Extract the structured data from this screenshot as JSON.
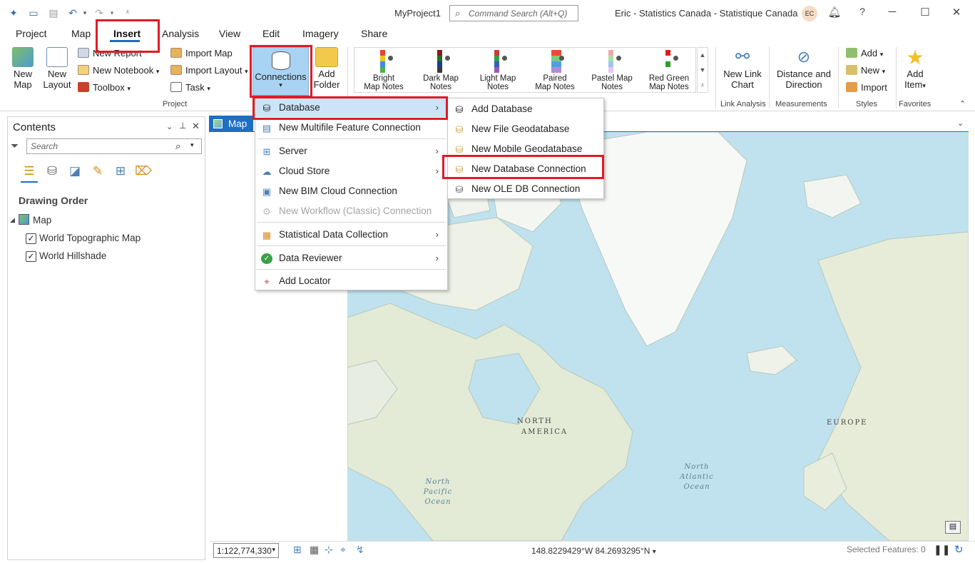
{
  "window": {
    "title": "MyProject1",
    "command_search_placeholder": "Command Search (Alt+Q)",
    "user": "Eric - Statistics Canada - Statistique Canada",
    "avatar_initials": "EC",
    "help_label": "?"
  },
  "tabs": [
    "Project",
    "Map",
    "Insert",
    "Analysis",
    "View",
    "Edit",
    "Imagery",
    "Share"
  ],
  "ribbon": {
    "project": {
      "new_map": "New Map",
      "new_layout": "New Layout",
      "new_report": "New Report",
      "new_notebook": "New Notebook",
      "toolbox": "Toolbox",
      "import_map": "Import Map",
      "import_layout": "Import Layout",
      "task": "Task",
      "connections": "Connections",
      "add_folder_1": "Add",
      "add_folder_2": "Folder",
      "group_label": "Project"
    },
    "notes": [
      {
        "l1": "Bright",
        "l2": "Map Notes"
      },
      {
        "l1": "Dark Map",
        "l2": "Notes"
      },
      {
        "l1": "Light Map",
        "l2": "Notes"
      },
      {
        "l1": "Paired",
        "l2": "Map Notes"
      },
      {
        "l1": "Pastel Map",
        "l2": "Notes"
      },
      {
        "l1": "Red Green",
        "l2": "Map Notes"
      }
    ],
    "link": {
      "l1": "New Link",
      "l2": "Chart",
      "group": "Link Analysis"
    },
    "measure": {
      "l1": "Distance and",
      "l2": "Direction",
      "group": "Measurements"
    },
    "styles": {
      "add": "Add",
      "new": "New",
      "import": "Import",
      "group": "Styles"
    },
    "favorites": {
      "l1": "Add",
      "l2": "Item",
      "group": "Favorites"
    }
  },
  "contents": {
    "title": "Contents",
    "search_placeholder": "Search",
    "drawing_order": "Drawing Order",
    "map_layer": "Map",
    "layers": [
      "World Topographic Map",
      "World Hillshade"
    ]
  },
  "map": {
    "tab_label": "Map",
    "labels": {
      "na1": "NORTH",
      "na2": "AMERICA",
      "europe": "EUROPE",
      "npo1": "North",
      "npo2": "Pacific",
      "npo3": "Ocean",
      "nao1": "North",
      "nao2": "Atlantic",
      "nao3": "Ocean"
    }
  },
  "status": {
    "scale": "1:122,774,330",
    "coords": "148.8229429°W 84.2693295°N",
    "selected_features": "Selected Features: 0"
  },
  "connections_menu": {
    "items": [
      {
        "label": "Database",
        "submenu": true
      },
      {
        "label": "New Multifile Feature Connection"
      },
      {
        "label": "Server",
        "submenu": true
      },
      {
        "label": "Cloud Store",
        "submenu": true
      },
      {
        "label": "New BIM Cloud Connection"
      },
      {
        "label": "New Workflow (Classic) Connection",
        "disabled": true
      },
      {
        "label": "Statistical Data Collection",
        "submenu": true
      },
      {
        "label": "Data Reviewer",
        "submenu": true
      },
      {
        "label": "Add Locator"
      }
    ]
  },
  "database_menu": {
    "items": [
      "Add Database",
      "New File Geodatabase",
      "New Mobile Geodatabase",
      "New Database Connection",
      "New OLE DB Connection"
    ]
  },
  "colors": {
    "accent": "#1d6fc2",
    "highlight": "#e01b24",
    "menu_hover": "#cce4f7",
    "ocean": "#bfe2ee",
    "land": "#e6eddc"
  }
}
